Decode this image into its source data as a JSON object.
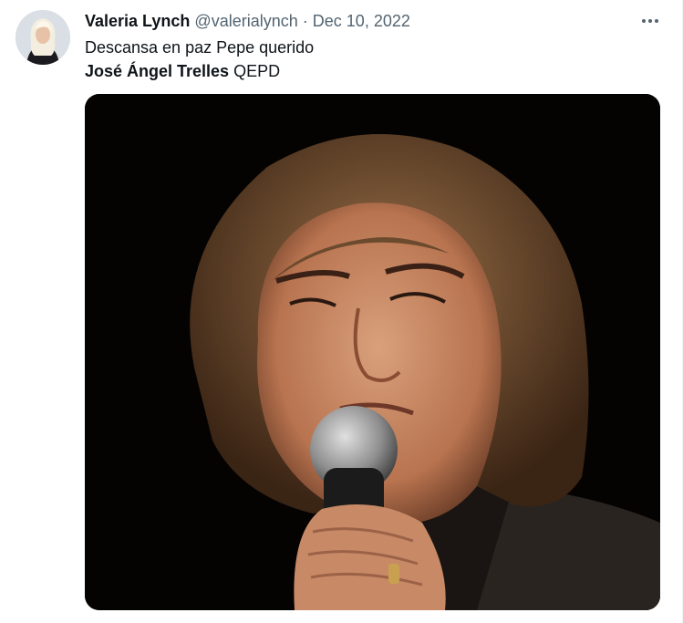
{
  "tweet": {
    "author_name": "Valeria Lynch",
    "author_handle": "@valerialynch",
    "separator": "·",
    "date": "Dec 10, 2022",
    "text_line1": "Descansa en paz Pepe querido",
    "text_line2_bold": "José Ángel Trelles",
    "text_line2_rest": " QEPD",
    "avatar_icon": "profile-avatar",
    "more_icon": "more-horizontal-icon"
  },
  "colors": {
    "text": "#0f1419",
    "secondary": "#536471"
  }
}
